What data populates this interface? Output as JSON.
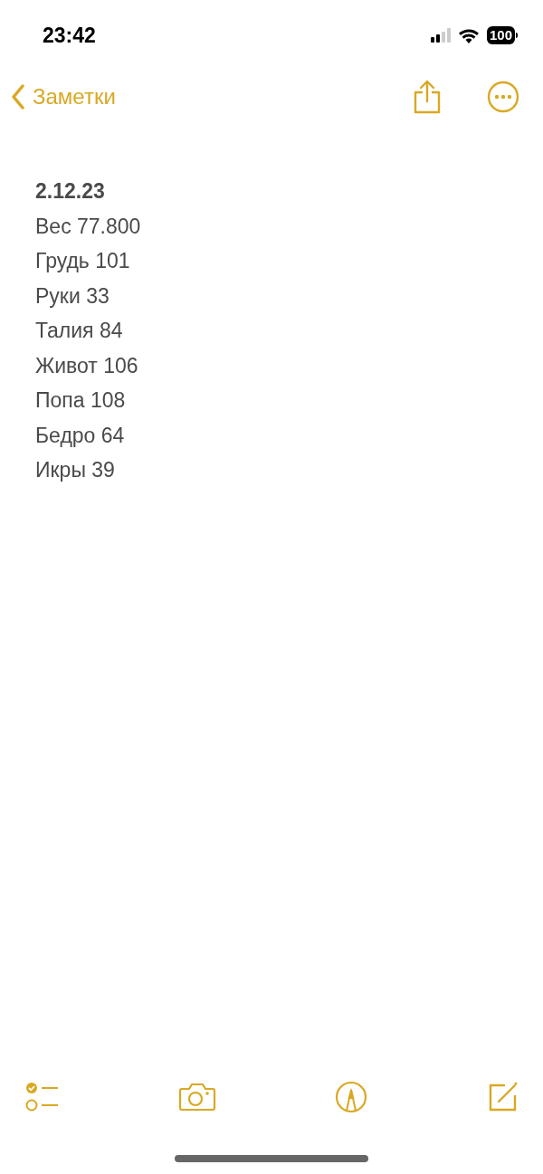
{
  "status_bar": {
    "time": "23:42",
    "battery": "100"
  },
  "nav": {
    "back_label": "Заметки"
  },
  "note": {
    "title": "2.12.23",
    "lines": [
      "Вес 77.800",
      "Грудь 101",
      "Руки 33",
      "Талия 84",
      "Живот 106",
      "Попа 108",
      "Бедро 64",
      "Икры 39"
    ]
  }
}
